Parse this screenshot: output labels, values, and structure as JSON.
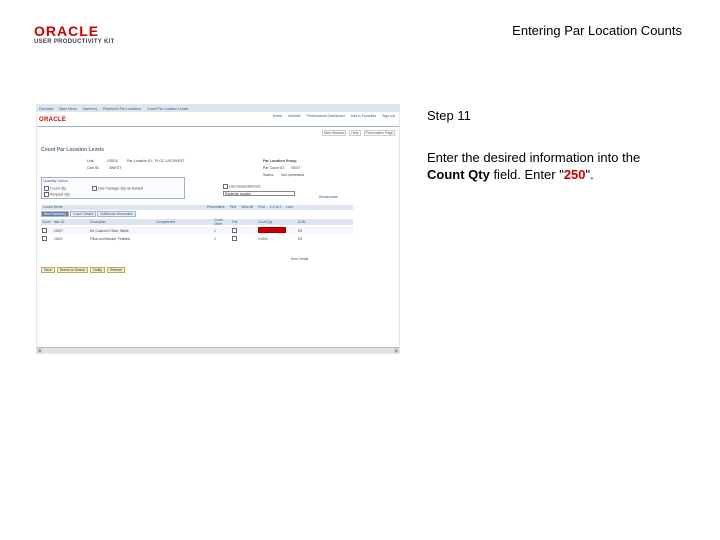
{
  "logo": {
    "brand": "ORACLE",
    "product": "USER PRODUCTIVITY KIT"
  },
  "document_title": "Entering Par Location Counts",
  "step_label": "Step 11",
  "instruction": {
    "pre": "Enter the desired information into the ",
    "field": "Count Qty",
    "mid": " field. Enter \"",
    "value": "250",
    "post": "\"."
  },
  "screenshot": {
    "nav": [
      "Favorites",
      "Main Menu",
      "Inventory",
      "Replenish Par Locations",
      "Count Par Location Levels"
    ],
    "brand": "ORACLE",
    "header_links": [
      "Home",
      "Worklist",
      "Performance Dashboard",
      "Add to Favorites",
      "Sign out"
    ],
    "header_actions": [
      "New Window",
      "Help",
      "Personalize Page"
    ],
    "page_title": "Count Par Location Levels",
    "fields": {
      "unit_label": "Unit:",
      "unit_value": "US010",
      "par_location_label": "Par Location ID:",
      "par_location_value": "PLOC-US-3WEST",
      "cart_id_label": "Cart ID:",
      "cart_id_value": "3WEST",
      "par_group_label": "Par Location Group",
      "par_count_label": "Par Count ID:",
      "par_count_value": "NEXT",
      "status_label": "Status:",
      "status_value": "Not processed"
    },
    "quantity_options": {
      "title": "Quantity Option",
      "count_qty": "Count Qty",
      "use_package": "Use Package Qty as Default",
      "request_qty": "Request Qty"
    },
    "use_replenishment": "Use Replenishment",
    "replenishment_select": "Replenish location",
    "recalc": "Recalculate",
    "grid": {
      "title": "Count Items",
      "nav_links": [
        "Personalize",
        "Find",
        "View All",
        "First",
        "1-2 of 2",
        "Last"
      ],
      "tabs": [
        "Item Summary",
        "Count Details",
        "Additional Information"
      ],
      "columns": [
        "Count",
        "Item ID",
        "Description",
        "Compartment",
        "Count Order",
        "Full",
        "Count Qty",
        "UOM"
      ],
      "rows": [
        {
          "item": "10007",
          "description": "Kit, Custom IV Start, Sterile",
          "order": "1",
          "qty": "",
          "uom": "EA"
        },
        {
          "item": "10001",
          "description": "Pillow and Blanket, Pediatric",
          "order": "2",
          "qty": "0.0000",
          "uom": "EA"
        }
      ]
    },
    "view_detail": "Item Detail",
    "buttons": [
      "Save",
      "Return to Search",
      "Notify",
      "Refresh"
    ]
  },
  "colors": {
    "brand_red": "#cc0000",
    "nav_blue": "#36597f",
    "header_bg": "#dde6f0"
  }
}
